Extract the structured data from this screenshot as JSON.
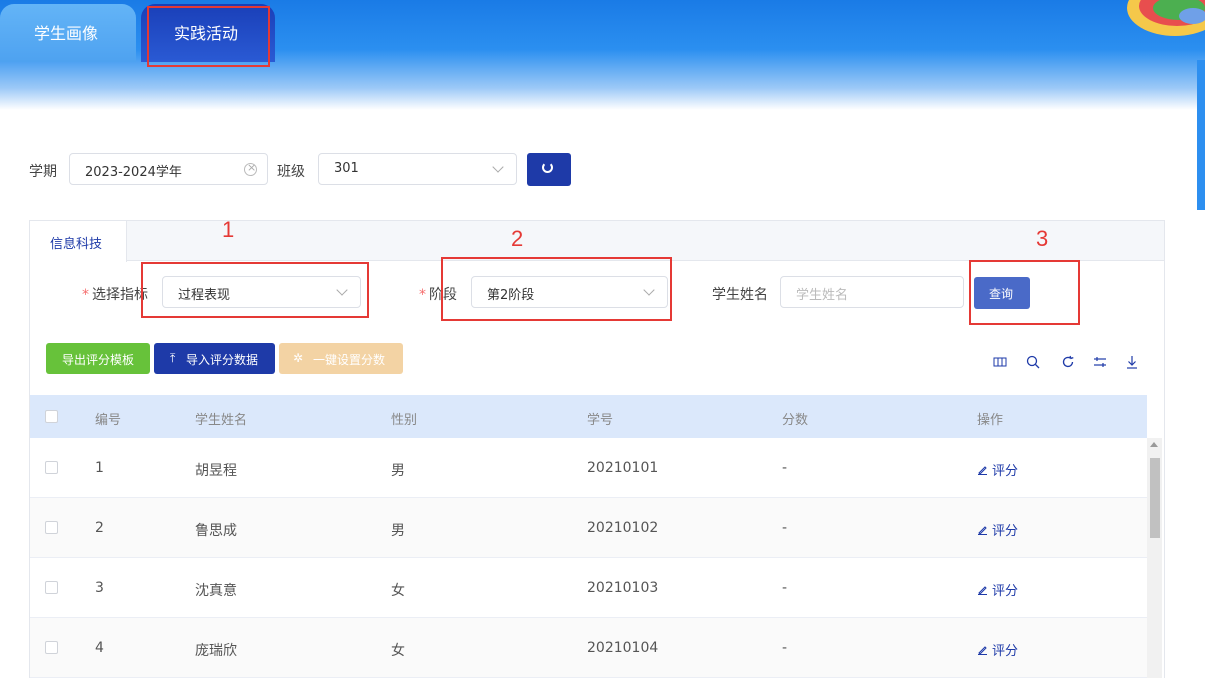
{
  "top_tabs": [
    {
      "label": "学生画像"
    },
    {
      "label": "实践活动"
    }
  ],
  "filter": {
    "term_label": "学期",
    "term_value": "2023-2024学年",
    "class_label": "班级",
    "class_value": "301"
  },
  "panel": {
    "tab_label": "信息科技",
    "indicator_label": "选择指标",
    "indicator_value": "过程表现",
    "stage_label": "阶段",
    "stage_value": "第2阶段",
    "student_name_label": "学生姓名",
    "student_name_placeholder": "学生姓名",
    "query_label": "查询",
    "required_mark": "*"
  },
  "actions": {
    "export_template": "导出评分模板",
    "import_scores": "导入评分数据",
    "set_scores": "一键设置分数"
  },
  "annotations": [
    "1",
    "2",
    "3"
  ],
  "table": {
    "columns": [
      "编号",
      "学生姓名",
      "性别",
      "学号",
      "分数",
      "操作"
    ],
    "rows": [
      {
        "id": "1",
        "name": "胡昱程",
        "gender": "男",
        "student_no": "20210101",
        "score": "-",
        "action": "评分"
      },
      {
        "id": "2",
        "name": "鲁思成",
        "gender": "男",
        "student_no": "20210102",
        "score": "-",
        "action": "评分"
      },
      {
        "id": "3",
        "name": "沈真意",
        "gender": "女",
        "student_no": "20210103",
        "score": "-",
        "action": "评分"
      },
      {
        "id": "4",
        "name": "庞瑞欣",
        "gender": "女",
        "student_no": "20210104",
        "score": "-",
        "action": "评分"
      }
    ]
  },
  "colors": {
    "primary": "#1e3aa8",
    "success": "#67c23a",
    "annotation": "#e53935",
    "header_bg": "#dbe8fb"
  }
}
